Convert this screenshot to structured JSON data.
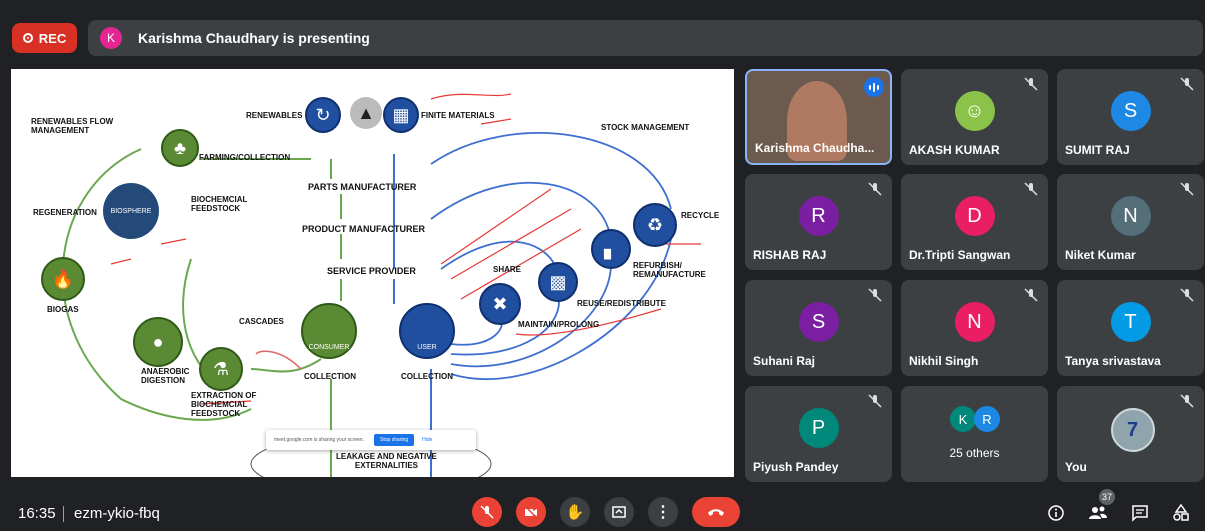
{
  "topbar": {
    "rec_label": "REC",
    "presenter_initial": "K",
    "presenting_text": "Karishma Chaudhary is presenting"
  },
  "slide": {
    "labels": {
      "renewables_flow": "RENEWABLES FLOW\nMANAGEMENT",
      "renewables": "RENEWABLES",
      "finite": "FINITE MATERIALS",
      "stock": "STOCK MANAGEMENT",
      "farming": "FARMING/COLLECTION",
      "regeneration": "REGENERATION",
      "biosphere": "BIOSPHERE",
      "biochem_feedstock": "BIOCHEMCIAL\nFEEDSTOCK",
      "parts": "PARTS MANUFACTURER",
      "product": "PRODUCT MANUFACTURER",
      "service": "SERVICE PROVIDER",
      "recycle": "RECYCLE",
      "refurbish": "REFURBISH/\nREMANUFACTURE",
      "share": "SHARE",
      "reuse": "REUSE/REDISTRIBUTE",
      "maintain": "MAINTAIN/PROLONG",
      "biogas": "BIOGAS",
      "cascades": "CASCADES",
      "consumer": "CONSUMER",
      "user": "USER",
      "collection1": "COLLECTION",
      "collection2": "COLLECTION",
      "anaerobic": "ANAEROBIC\nDIGESTION",
      "extraction": "EXTRACTION OF\nBIOCHEMCIAL\nFEEDSTOCK",
      "leakage": "LEAKAGE AND NEGATIVE\nEXTERNALITIES"
    },
    "share_bar": {
      "text": "meet.google.com is sharing your screen.",
      "stop": "Stop sharing",
      "hide": "Hide"
    }
  },
  "participants": [
    {
      "name": "Karishma Chaudha...",
      "initial": "",
      "color": "#6d5a4e",
      "speaking": true
    },
    {
      "name": "AKASH KUMAR",
      "initial": "",
      "color": "#8bc34a",
      "photo": true
    },
    {
      "name": "SUMIT RAJ",
      "initial": "S",
      "color": "#1e88e5"
    },
    {
      "name": "RISHAB RAJ",
      "initial": "R",
      "color": "#7b1fa2"
    },
    {
      "name": "Dr.Tripti Sangwan",
      "initial": "D",
      "color": "#e91e63"
    },
    {
      "name": "Niket Kumar",
      "initial": "N",
      "color": "#546e7a"
    },
    {
      "name": "Suhani Raj",
      "initial": "S",
      "color": "#7b1fa2"
    },
    {
      "name": "Nikhil Singh",
      "initial": "N",
      "color": "#e91e63"
    },
    {
      "name": "Tanya srivastava",
      "initial": "T",
      "color": "#039be5"
    },
    {
      "name": "Piyush Pandey",
      "initial": "P",
      "color": "#00897b"
    },
    {
      "name": "25 others",
      "initial": "K",
      "initial2": "R",
      "color": "#00897b",
      "color2": "#1e88e5"
    },
    {
      "name": "You",
      "initial": "7",
      "color": "#90a4ae"
    }
  ],
  "bottombar": {
    "time": "16:35",
    "meeting_code": "ezm-ykio-fbq",
    "participant_count": "37"
  }
}
